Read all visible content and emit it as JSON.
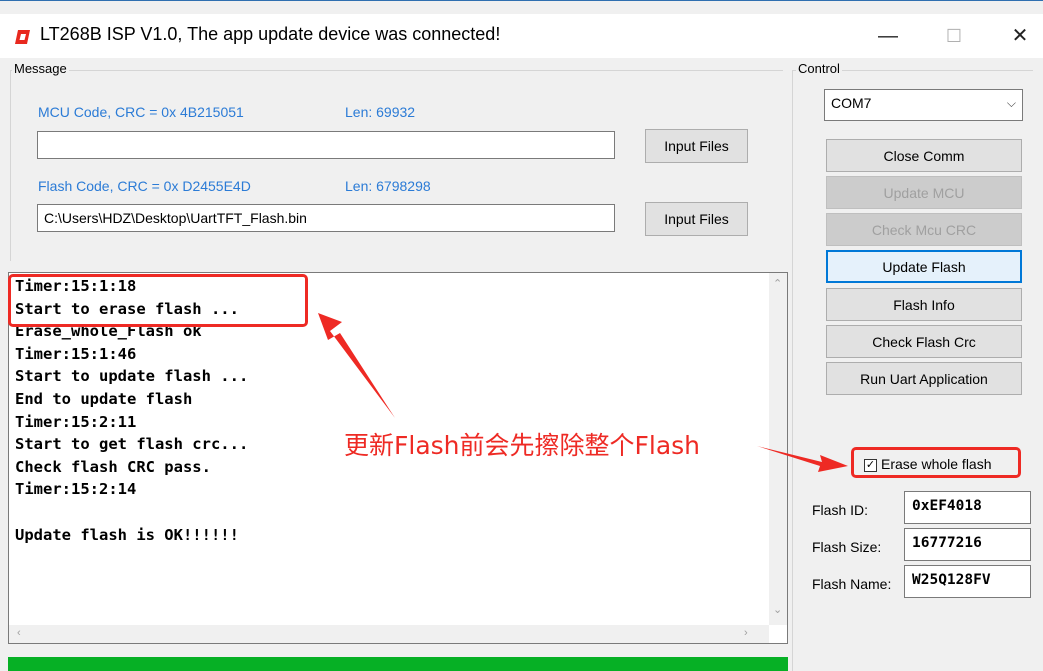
{
  "window": {
    "title": "LT268B ISP V1.0, The app update device was connected!",
    "minimize_glyph": "—",
    "maximize_glyph": "☐",
    "close_glyph": "✕"
  },
  "message_group": {
    "label": "Message",
    "mcu_code_label": "MCU Code, CRC = 0x 4B215051",
    "mcu_len_label": "Len:  69932",
    "mcu_path_value": "",
    "flash_code_label": "Flash Code, CRC = 0x D2455E4D",
    "flash_len_label": "Len:  6798298",
    "flash_path_value": "C:\\Users\\HDZ\\Desktop\\UartTFT_Flash.bin",
    "input_files_button_1": "Input Files",
    "input_files_button_2": "Input Files"
  },
  "log": {
    "lines": [
      "Timer:15:1:18",
      "Start to erase flash ...",
      "Erase_whole_Flash ok",
      "Timer:15:1:46",
      "Start to update flash ...",
      "End to update flash",
      "Timer:15:2:11",
      "Start to get flash crc...",
      "Check flash CRC pass.",
      "Timer:15:2:14",
      "",
      "Update flash is OK!!!!!!"
    ]
  },
  "progress": {
    "percent": 100,
    "color": "#06b025"
  },
  "control_group": {
    "label": "Control",
    "com_port": "COM7",
    "buttons": {
      "close_comm": "Close Comm",
      "update_mcu": "Update MCU",
      "check_mcu_crc": "Check Mcu CRC",
      "update_flash": "Update Flash",
      "flash_info": "Flash Info",
      "check_flash_crc": "Check Flash Crc",
      "run_uart_application": "Run Uart Application"
    },
    "erase_whole_flash_label": "Erase whole flash",
    "erase_whole_flash_checked": true,
    "flash_id_label": "Flash ID:",
    "flash_id_value": "0xEF4018",
    "flash_size_label": "Flash Size:",
    "flash_size_value": "16777216",
    "flash_name_label": "Flash Name:",
    "flash_name_value": "W25Q128FV"
  },
  "annotation": {
    "text": "更新Flash前会先擦除整个Flash",
    "color": "#ee2a24"
  }
}
